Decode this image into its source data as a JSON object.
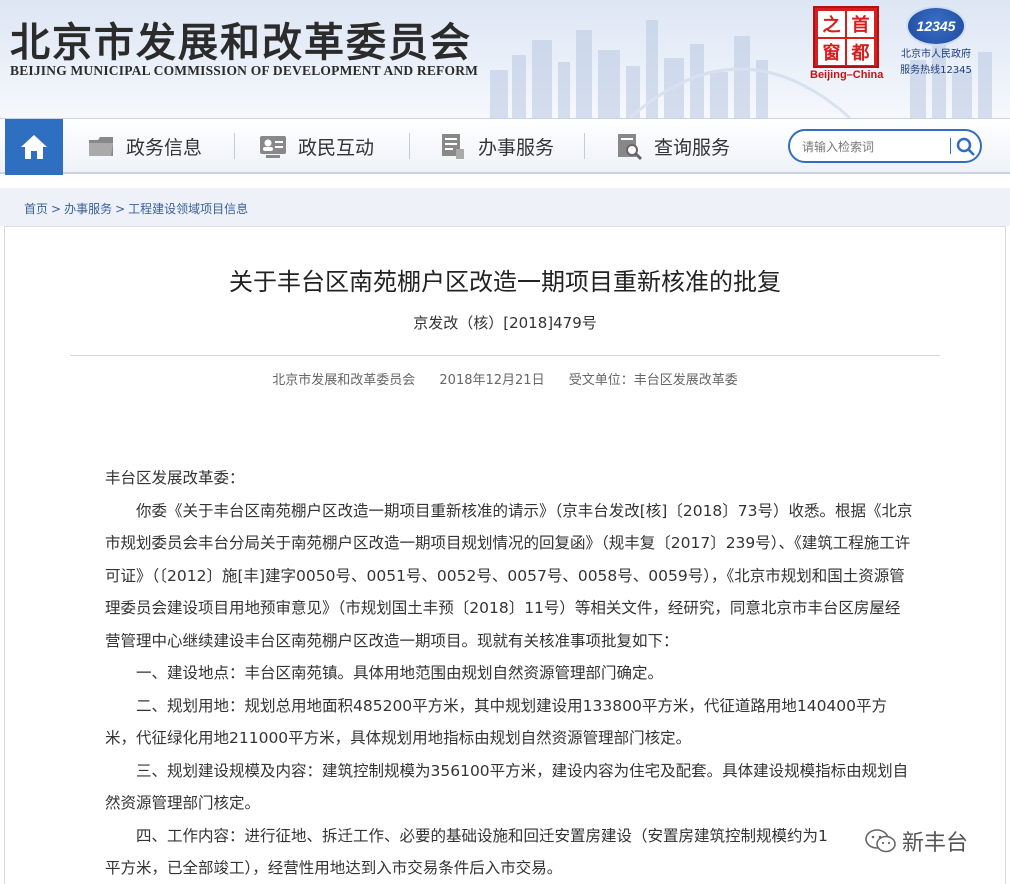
{
  "header": {
    "title_cn": "北京市发展和改革委员会",
    "title_en": "BEIJING MUNICIPAL COMMISSION OF DEVELOPMENT AND REFORM",
    "capital_logo": {
      "chars": [
        "之",
        "首",
        "窗",
        "都"
      ],
      "caption": "Beijing–China"
    },
    "hotline": {
      "number": "12345",
      "line1": "北京市人民政府",
      "line2": "服务热线12345"
    }
  },
  "nav": {
    "home_icon": "home-icon",
    "items": [
      {
        "label": "政务信息",
        "icon": "folder-icon"
      },
      {
        "label": "政民互动",
        "icon": "id-card-icon"
      },
      {
        "label": "办事服务",
        "icon": "document-hand-icon"
      },
      {
        "label": "查询服务",
        "icon": "search-document-icon"
      }
    ],
    "search": {
      "placeholder": "请输入检索词"
    },
    "accent": "#2f6fc1"
  },
  "breadcrumb": {
    "items": [
      "首页",
      "办事服务",
      "工程建设领域项目信息"
    ],
    "separator": ">"
  },
  "article": {
    "title": "关于丰台区南苑棚户区改造一期项目重新核准的批复",
    "doc_number": "京发改（核）[2018]479号",
    "publisher": "北京市发展和改革委员会",
    "date": "2018年12月21日",
    "recipient": "受文单位：丰台区发展改革委",
    "body": [
      "丰台区发展改革委：",
      "你委《关于丰台区南苑棚户区改造一期项目重新核准的请示》（京丰台发改[核]〔2018〕73号）收悉。根据《北京市规划委员会丰台分局关于南苑棚户区改造一期项目规划情况的回复函》（规丰复〔2017〕239号）、《建筑工程施工许可证》（〔2012〕施[丰]建字0050号、0051号、0052号、0057号、0058号、0059号），《北京市规划和国土资源管理委员会建设项目用地预审意见》（市规划国土丰预〔2018〕11号）等相关文件，经研究，同意北京市丰台区房屋经营管理中心继续建设丰台区南苑棚户区改造一期项目。现就有关核准事项批复如下：",
      "一、建设地点：丰台区南苑镇。具体用地范围由规划自然资源管理部门确定。",
      "二、规划用地：规划总用地面积485200平方米，其中规划建设用133800平方米，代征道路用地140400平方米，代征绿化用地211000平方米，具体规划用地指标由规划自然资源管理部门核定。",
      "三、规划建设规模及内容：建筑控制规模为356100平方米，建设内容为住宅及配套。具体建设规模指标由规划自然资源管理部门核定。",
      "四、工作内容：进行征地、拆迁工作、必要的基础设施和回迁安置房建设（安置房建筑控制规模约为1",
      "平方米，已全部竣工），经营性用地达到入市交易条件后入市交易。"
    ]
  },
  "watermark": {
    "text": "新丰台",
    "icon": "wechat-icon"
  }
}
